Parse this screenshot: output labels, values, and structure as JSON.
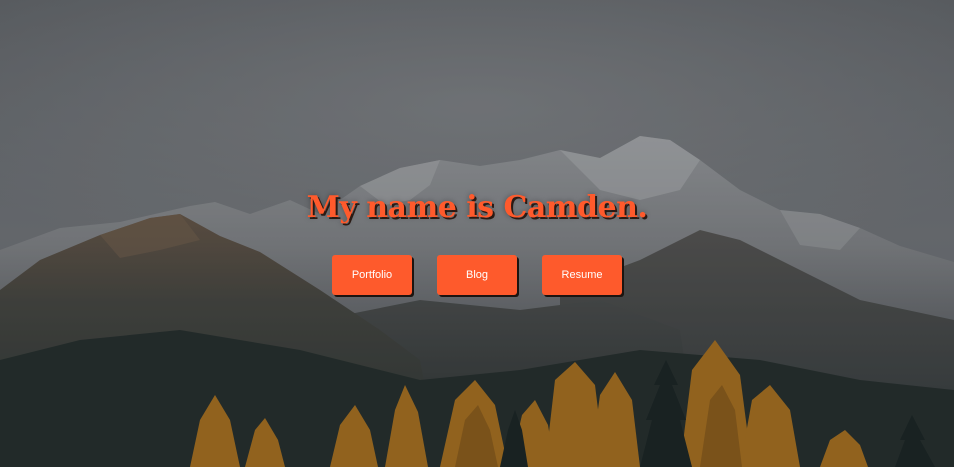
{
  "hero": {
    "heading": "My name is Camden.",
    "buttons": [
      {
        "label": "Portfolio"
      },
      {
        "label": "Blog"
      },
      {
        "label": "Resume"
      }
    ]
  },
  "colors": {
    "accent": "#fe5a2c",
    "button_text": "#ffffff",
    "overlay": "#14161a"
  }
}
